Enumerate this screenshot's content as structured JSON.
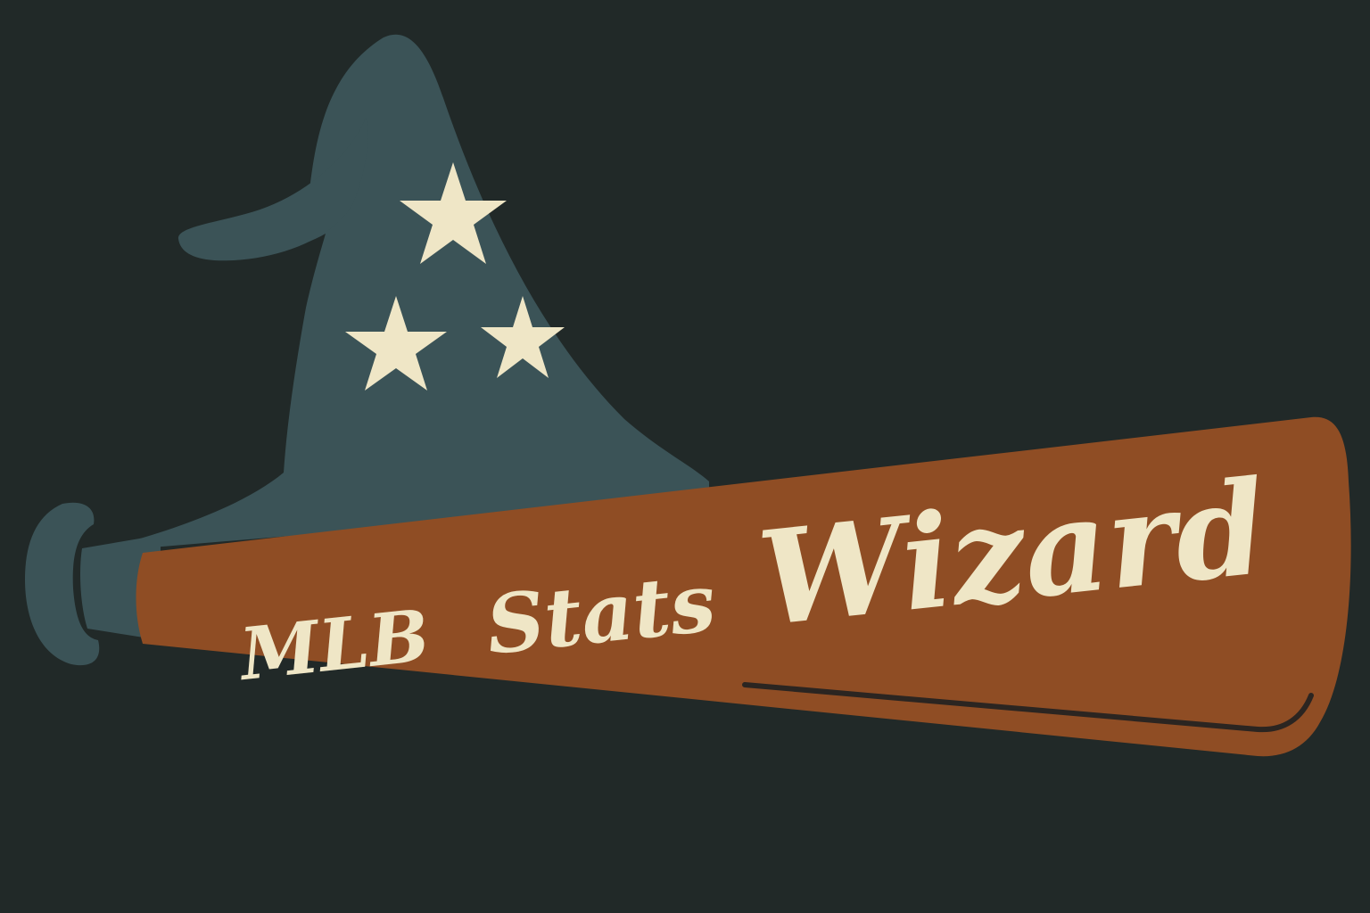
{
  "logo": {
    "wordmark": {
      "part1": "MLB",
      "part2": "Stats",
      "part3": "Wizard"
    },
    "icons": {
      "hat": "wizard-hat-icon",
      "bat": "baseball-bat-icon",
      "star": "star-icon"
    },
    "colors": {
      "background": "#212928",
      "hat": "#3b5357",
      "bat": "#8f4d24",
      "bat_shadow": "#2b2521",
      "stars_and_text": "#efe6c6"
    }
  }
}
